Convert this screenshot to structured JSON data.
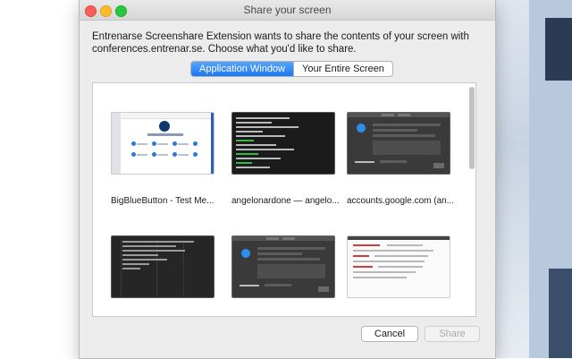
{
  "window": {
    "title": "Share your screen",
    "message_line1": "Entrenarse Screenshare Extension wants to share the contents of your screen with",
    "message_line2": "conferences.entrenar.se. Choose what you'd like to share."
  },
  "tabs": [
    {
      "label": "Application Window",
      "selected": true
    },
    {
      "label": "Your Entire Screen",
      "selected": false
    }
  ],
  "windows": [
    {
      "label": "BigBlueButton - Test Me...",
      "icon": "bigbluebutton-thumbnail"
    },
    {
      "label": "angelonardone — angelo...",
      "icon": "terminal-thumbnail"
    },
    {
      "label": "accounts.google.com (an...",
      "icon": "settings-dialog-thumbnail"
    },
    {
      "label": "",
      "icon": "list-app-thumbnail"
    },
    {
      "label": "",
      "icon": "settings-dialog-thumbnail"
    },
    {
      "label": "",
      "icon": "webpage-thumbnail"
    }
  ],
  "buttons": {
    "cancel": "Cancel",
    "share": "Share"
  },
  "colors": {
    "accent": "#1b78f2",
    "close": "#fc5f57",
    "minimize": "#fdbc2e",
    "maximize": "#29c840"
  }
}
